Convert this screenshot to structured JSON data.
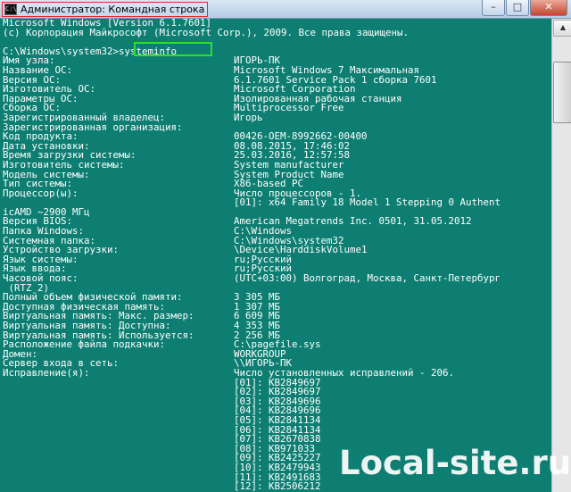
{
  "window": {
    "title": "Администратор: Командная строка",
    "icon": "cmd-icon",
    "buttons": {
      "minimize": "–",
      "maximize": "□",
      "close": "✕"
    }
  },
  "console": {
    "header": [
      "Microsoft Windows [Version 6.1.7601]",
      "(c) Корпорация Майкрософт (Microsoft Corp.), 2009. Все права защищены."
    ],
    "prompt": "C:\\Windows\\system32>",
    "command": "systeminfo",
    "rows": [
      {
        "k": "Имя узла:",
        "v": "ИГОРЬ-ПК"
      },
      {
        "k": "Название ОС:",
        "v": "Microsoft Windows 7 Максимальная"
      },
      {
        "k": "Версия ОС:",
        "v": "6.1.7601 Service Pack 1 сборка 7601"
      },
      {
        "k": "Изготовитель ОС:",
        "v": "Microsoft Corporation"
      },
      {
        "k": "Параметры ОС:",
        "v": "Изолированная рабочая станция"
      },
      {
        "k": "Сборка ОС:",
        "v": "Multiprocessor Free"
      },
      {
        "k": "Зарегистрированный владелец:",
        "v": "Игорь"
      },
      {
        "k": "Зарегистрированная организация:",
        "v": ""
      },
      {
        "k": "Код продукта:",
        "v": "00426-OEM-8992662-00400"
      },
      {
        "k": "Дата установки:",
        "v": "08.08.2015, 17:46:02"
      },
      {
        "k": "Время загрузки системы:",
        "v": "25.03.2016, 12:57:58"
      },
      {
        "k": "Изготовитель системы:",
        "v": "System manufacturer"
      },
      {
        "k": "Модель системы:",
        "v": "System Product Name"
      },
      {
        "k": "Тип системы:",
        "v": "X86-based PC"
      },
      {
        "k": "Процессор(ы):",
        "v": "Число процессоров - 1."
      },
      {
        "k": "",
        "v": "[01]: x64 Family 18 Model 1 Stepping 0 Authent"
      },
      {
        "k": "icAMD ~2900 МГц",
        "v": ""
      },
      {
        "k": "Версия BIOS:",
        "v": "American Megatrends Inc. 0501, 31.05.2012"
      },
      {
        "k": "Папка Windows:",
        "v": "C:\\Windows"
      },
      {
        "k": "Системная папка:",
        "v": "C:\\Windows\\system32"
      },
      {
        "k": "Устройство загрузки:",
        "v": "\\Device\\HarddiskVolume1"
      },
      {
        "k": "Язык системы:",
        "v": "ru;Русский"
      },
      {
        "k": "Язык ввода:",
        "v": "ru;Русский"
      },
      {
        "k": "Часовой пояс:",
        "v": "(UTC+03:00) Волгоград, Москва, Санкт-Петербург"
      },
      {
        "k": " (RTZ 2)",
        "v": ""
      },
      {
        "k": "Полный объем физической памяти:",
        "v": "3 305 МБ"
      },
      {
        "k": "Доступная физическая память:",
        "v": "1 307 МБ"
      },
      {
        "k": "Виртуальная память: Макс. размер:",
        "v": "6 609 МБ"
      },
      {
        "k": "Виртуальная память: Доступна:",
        "v": "4 353 МБ"
      },
      {
        "k": "Виртуальная память: Используется:",
        "v": "2 256 МБ"
      },
      {
        "k": "Расположение файла подкачки:",
        "v": "C:\\pagefile.sys"
      },
      {
        "k": "Домен:",
        "v": "WORKGROUP"
      },
      {
        "k": "Сервер входа в сеть:",
        "v": "\\\\ИГОРЬ-ПК"
      },
      {
        "k": "Исправление(я):",
        "v": "Число установленных исправлений - 206."
      },
      {
        "k": "",
        "v": "[01]: KB2849697"
      },
      {
        "k": "",
        "v": "[02]: KB2849697"
      },
      {
        "k": "",
        "v": "[03]: KB2849696"
      },
      {
        "k": "",
        "v": "[04]: KB2849696"
      },
      {
        "k": "",
        "v": "[05]: KB2841134"
      },
      {
        "k": "",
        "v": "[06]: KB2841134"
      },
      {
        "k": "",
        "v": "[07]: KB2670838"
      },
      {
        "k": "",
        "v": "[08]: KB971033"
      },
      {
        "k": "",
        "v": "[09]: KB2425227"
      },
      {
        "k": "",
        "v": "[10]: KB2479943"
      },
      {
        "k": "",
        "v": "[11]: KB2491683"
      },
      {
        "k": "",
        "v": "[12]: KB2506212"
      }
    ]
  },
  "scrollbar": {
    "up_icon": "▲",
    "down_icon": "▼"
  },
  "watermark": "Local-site.ru",
  "colors": {
    "console_bg": "#0e7e72",
    "console_text": "#ffffff",
    "title_highlight": "#e0292b",
    "command_highlight": "#2be02b"
  }
}
